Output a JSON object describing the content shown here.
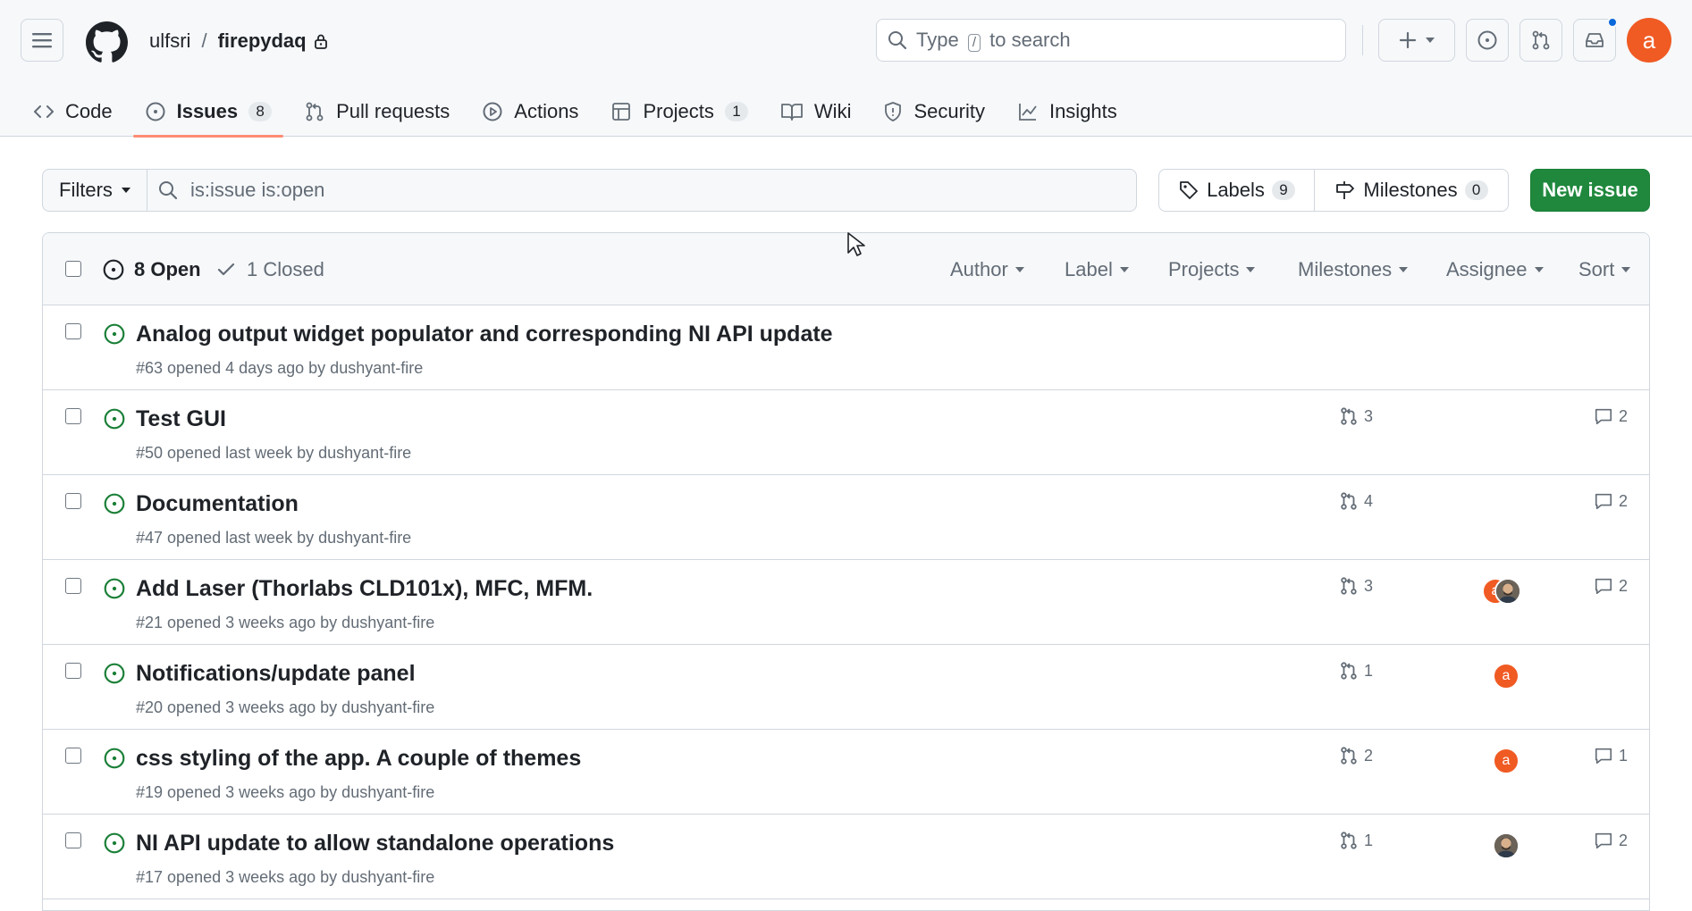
{
  "header": {
    "owner": "ulfsri",
    "separator": "/",
    "repo": "firepydaq",
    "search_text_before": "Type",
    "search_key": "/",
    "search_text_after": "to search",
    "avatar_letter": "a"
  },
  "tabs": [
    {
      "label": "Code",
      "icon": "code-icon"
    },
    {
      "label": "Issues",
      "icon": "issue-opened-icon",
      "count": "8",
      "selected": true
    },
    {
      "label": "Pull requests",
      "icon": "git-pull-request-icon"
    },
    {
      "label": "Actions",
      "icon": "play-icon"
    },
    {
      "label": "Projects",
      "icon": "table-icon",
      "count": "1"
    },
    {
      "label": "Wiki",
      "icon": "book-icon"
    },
    {
      "label": "Security",
      "icon": "shield-icon"
    },
    {
      "label": "Insights",
      "icon": "graph-icon"
    }
  ],
  "subnav": {
    "filters_label": "Filters",
    "filter_query": "is:issue is:open",
    "labels_label": "Labels",
    "labels_count": "9",
    "milestones_label": "Milestones",
    "milestones_count": "0",
    "new_issue_label": "New issue"
  },
  "list_header": {
    "open_label": "8 Open",
    "closed_label": "1 Closed",
    "filters": [
      "Author",
      "Label",
      "Projects",
      "Milestones",
      "Assignee",
      "Sort"
    ]
  },
  "issues": [
    {
      "title": "Analog output widget populator and corresponding NI API update",
      "meta": "#63 opened 4 days ago by dushyant-fire",
      "prs": "",
      "comments": "",
      "assignees": []
    },
    {
      "title": "Test GUI",
      "meta": "#50 opened last week by dushyant-fire",
      "prs": "3",
      "comments": "2",
      "assignees": []
    },
    {
      "title": "Documentation",
      "meta": "#47 opened last week by dushyant-fire",
      "prs": "4",
      "comments": "2",
      "assignees": []
    },
    {
      "title": "Add Laser (Thorlabs CLD101x), MFC, MFM.",
      "meta": "#21 opened 3 weeks ago by dushyant-fire",
      "prs": "3",
      "comments": "2",
      "assignees": [
        "a",
        "photo"
      ]
    },
    {
      "title": "Notifications/update panel",
      "meta": "#20 opened 3 weeks ago by dushyant-fire",
      "prs": "1",
      "comments": "",
      "assignees": [
        "a"
      ]
    },
    {
      "title": "css styling of the app. A couple of themes",
      "meta": "#19 opened 3 weeks ago by dushyant-fire",
      "prs": "2",
      "comments": "1",
      "assignees": [
        "a"
      ]
    },
    {
      "title": "NI API update to allow standalone operations",
      "meta": "#17 opened 3 weeks ago by dushyant-fire",
      "prs": "1",
      "comments": "2",
      "assignees": [
        "photo"
      ]
    }
  ],
  "colors": {
    "accent_green": "#1f883d",
    "open_icon": "#1a7f37",
    "tab_underline": "#fd8c73",
    "avatar_orange": "#f05a23",
    "notification_dot": "#0969da"
  }
}
